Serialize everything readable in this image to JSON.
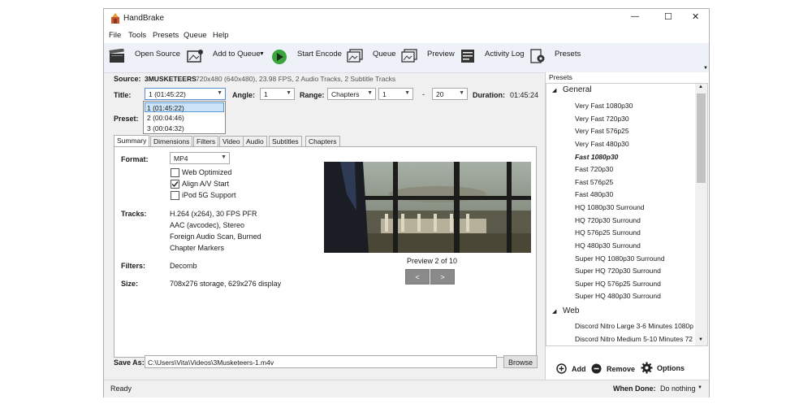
{
  "window": {
    "title": "HandBrake",
    "controls": {
      "minimize": "—",
      "maximize": "☐",
      "close": "✕"
    }
  },
  "menu": [
    "File",
    "Tools",
    "Presets",
    "Queue",
    "Help"
  ],
  "toolbar": {
    "open_source": "Open Source",
    "add_to_queue": "Add to Queue",
    "start_encode": "Start Encode",
    "queue": "Queue",
    "preview": "Preview",
    "activity_log": "Activity Log",
    "presets": "Presets"
  },
  "source": {
    "label": "Source:",
    "name": "3MUSKETEERS",
    "info": "720x480 (640x480), 23.98 FPS, 2 Audio Tracks, 2 Subtitle Tracks"
  },
  "title_row": {
    "title_label": "Title:",
    "title_value": "1 (01:45:22)",
    "angle_label": "Angle:",
    "angle_value": "1",
    "range_label": "Range:",
    "range_value": "Chapters",
    "range_start": "1",
    "range_sep": "-",
    "range_end": "20",
    "duration_label": "Duration:",
    "duration_value": "01:45:24"
  },
  "title_dropdown": [
    "1 (01:45:22)",
    "2 (00:04:46)",
    "3 (00:04:32)"
  ],
  "preset_label": "Preset:",
  "tabs": [
    "Summary",
    "Dimensions",
    "Filters",
    "Video",
    "Audio",
    "Subtitles",
    "Chapters"
  ],
  "summary": {
    "format_label": "Format:",
    "format_value": "MP4",
    "web_optimized": "Web Optimized",
    "align_av": "Align A/V Start",
    "ipod": "iPod 5G Support",
    "tracks_label": "Tracks:",
    "tracks": [
      "H.264 (x264), 30 FPS PFR",
      "AAC (avcodec), Stereo",
      "Foreign Audio Scan, Burned",
      "Chapter Markers"
    ],
    "filters_label": "Filters:",
    "filters_value": "Decomb",
    "size_label": "Size:",
    "size_value": "708x276 storage, 629x276 display",
    "preview_caption": "Preview 2 of 10",
    "prev_btn": "<",
    "next_btn": ">"
  },
  "save_as": {
    "label": "Save As:",
    "path": "C:\\Users\\Vita\\Videos\\3Musketeers-1.m4v",
    "browse": "Browse"
  },
  "presets_panel": {
    "header": "Presets",
    "groups": [
      {
        "name": "General",
        "items": [
          "Very Fast 1080p30",
          "Very Fast 720p30",
          "Very Fast 576p25",
          "Very Fast 480p30",
          "Fast 1080p30",
          "Fast 720p30",
          "Fast 576p25",
          "Fast 480p30",
          "HQ 1080p30 Surround",
          "HQ 720p30 Surround",
          "HQ 576p25 Surround",
          "HQ 480p30 Surround",
          "Super HQ 1080p30 Surround",
          "Super HQ 720p30 Surround",
          "Super HQ 576p25 Surround",
          "Super HQ 480p30 Surround"
        ]
      },
      {
        "name": "Web",
        "items": [
          "Discord Nitro Large 3-6 Minutes 1080p",
          "Discord Nitro Medium 5-10 Minutes 72"
        ]
      }
    ],
    "selected": "Fast 1080p30",
    "add": "Add",
    "remove": "Remove",
    "options": "Options"
  },
  "status": {
    "ready": "Ready",
    "when_done_label": "When Done:",
    "when_done_value": "Do nothing"
  }
}
